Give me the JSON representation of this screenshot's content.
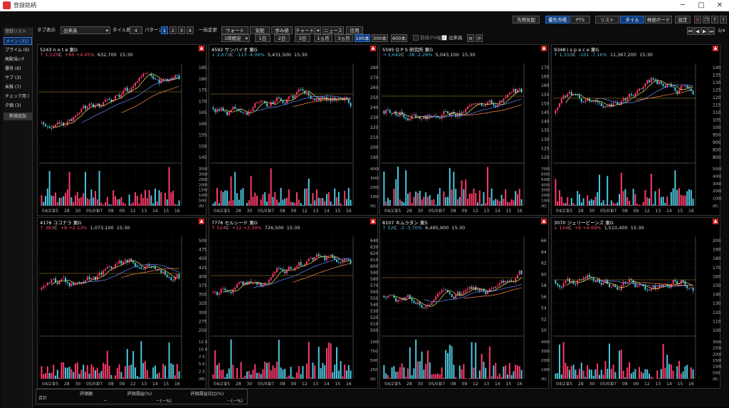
{
  "window": {
    "title": "登録銘柄",
    "min": "─",
    "max": "□",
    "close": "✕"
  },
  "topbar": {
    "buttons": [
      "先物気配",
      "優先市場",
      "PTS",
      "リスト",
      "タイル",
      "株価ボード",
      "設定"
    ],
    "active": [
      "優先市場",
      "タイル"
    ],
    "page": "3/4"
  },
  "toolbar": {
    "tab_display": "タブ表示",
    "sort": "出来高",
    "tile_label": "タイル数",
    "tile_count": "4",
    "pattern_label": "パターン",
    "patterns": [
      "1",
      "2",
      "3",
      "4"
    ],
    "pattern_active": "1",
    "bulk_change": "一括変更",
    "tabs": [
      "ウォート",
      "気配",
      "歩み値",
      "チャート",
      "ニュース",
      "信用"
    ],
    "interval": "1時間足",
    "ranges": [
      "1日",
      "2日",
      "3日",
      "1ヵ月",
      "3ヵ月",
      "100本",
      "300本",
      "600本"
    ],
    "range_active": "100本",
    "chk_ma": "前値3%幅",
    "chk_vol": "出来高"
  },
  "sidebar": {
    "header": "登録リスト",
    "items": [
      "メイン (31)",
      "プライム (6)",
      "高配当ｪｯﾁ",
      "優待 (6)",
      "サブ (3)",
      "米株 (7)",
      "チェック用 (",
      "夕鎮 (3)"
    ],
    "selected": 0,
    "add": "新規追加"
  },
  "panels": [
    {
      "code": "5243",
      "name": "n o t e",
      "mkt": "東G",
      "arrow": "↑",
      "price": "1,525",
      "flag": "C",
      "chg": "+65",
      "pct": "+4.45%",
      "vol": "632,700",
      "time": "15:30",
      "dir": "up"
    },
    {
      "code": "4592",
      "name": "サンバイオ",
      "mkt": "東G",
      "arrow": "↓",
      "price": "2,673",
      "flag": "C",
      "chg": "-113",
      "pct": "-4.06%",
      "vol": "5,431,500",
      "time": "15:30",
      "dir": "dn"
    },
    {
      "code": "5595",
      "name": "Q P S 研究所",
      "mkt": "東G",
      "arrow": "→",
      "price": "1,642",
      "flag": "C",
      "chg": "-38",
      "pct": "-2.26%",
      "vol": "5,043,100",
      "time": "15:30",
      "dir": "dn"
    },
    {
      "code": "9348",
      "name": "i s p a c e",
      "mkt": "東G",
      "arrow": "↑",
      "price": "1,310",
      "flag": "C",
      "chg": "-101",
      "pct": "-7.16%",
      "vol": "11,367,200",
      "time": "15:30",
      "dir": "dn"
    },
    {
      "code": "4176",
      "name": "ココナラ",
      "mkt": "東G",
      "arrow": "↑",
      "price": "383",
      "flag": "C",
      "chg": "+8",
      "pct": "+2.13%",
      "vol": "1,073,100",
      "time": "15:30",
      "dir": "up"
    },
    {
      "code": "7776",
      "name": "セルシード",
      "mkt": "東G",
      "arrow": "↑",
      "price": "524",
      "flag": "C",
      "chg": "+12",
      "pct": "+2.34%",
      "vol": "726,500",
      "time": "15:30",
      "dir": "up"
    },
    {
      "code": "8107",
      "name": "キムラタン",
      "mkt": "東S",
      "arrow": "↑",
      "price": "52",
      "flag": "C",
      "chg": "-2",
      "pct": "-3.70%",
      "vol": "6,495,900",
      "time": "15:30",
      "dir": "dn"
    },
    {
      "code": "3070",
      "name": "ジェリービーンズ",
      "mkt": "東G",
      "arrow": "↓",
      "price": "134",
      "flag": "C",
      "chg": "+6",
      "pct": "+4.69%",
      "vol": "1,510,400",
      "time": "15:30",
      "dir": "up"
    }
  ],
  "chart_data": [
    {
      "type": "candlestick",
      "price_ticks": [
        "1850",
        "1800",
        "1750",
        "1700",
        "1650",
        "1600",
        "1550",
        "1500",
        "1450"
      ],
      "vol_ticks": [
        "3500",
        "3000",
        "2500",
        "2000",
        "1500",
        "1000",
        "500",
        "(K)"
      ],
      "x_ticks": [
        "04/23",
        "25",
        "28",
        "30",
        "05/01",
        "07",
        "08",
        "09",
        "12",
        "13",
        "14",
        "15",
        "16"
      ]
    },
    {
      "type": "candlestick",
      "price_ticks": [
        "2800",
        "2700",
        "2600",
        "2500",
        "2400",
        "2300",
        "2200",
        "2100",
        "2000",
        "1900"
      ],
      "vol_ticks": [
        "4000",
        "3000",
        "2000",
        "1000",
        "(K)"
      ],
      "x_ticks": [
        "04/23",
        "25",
        "28",
        "30",
        "05/01",
        "07",
        "08",
        "09",
        "12",
        "13",
        "14",
        "15",
        "16"
      ]
    },
    {
      "type": "candlestick",
      "price_ticks": [
        "1700",
        "1650",
        "1600",
        "1550",
        "1500",
        "1450",
        "1400",
        "1350",
        "1300",
        "1250",
        "1200"
      ],
      "vol_ticks": [
        "7000",
        "6000",
        "5000",
        "4000",
        "3000",
        "2000",
        "1000",
        "(K)"
      ],
      "x_ticks": [
        "04/23",
        "25",
        "28",
        "30",
        "05/01",
        "07",
        "08",
        "09",
        "12",
        "13",
        "14",
        "15",
        "16"
      ]
    },
    {
      "type": "candlestick",
      "price_ticks": [
        "1400",
        "1350",
        "1300",
        "1250",
        "1200",
        "1150",
        "1100",
        "1050",
        "1000",
        "950",
        "900",
        "850",
        "800"
      ],
      "vol_ticks": [
        "5000",
        "4000",
        "3000",
        "2000",
        "1000",
        "(K)"
      ],
      "x_ticks": [
        "04/23",
        "25",
        "28",
        "30",
        "05/01",
        "07",
        "08",
        "09",
        "12",
        "13",
        "14",
        "15",
        "16"
      ]
    },
    {
      "type": "candlestick",
      "price_ticks": [
        "500",
        "475",
        "450",
        "425",
        "400",
        "375",
        "350",
        "325",
        "300",
        "275",
        "250"
      ],
      "vol_ticks": [
        "12.5",
        "10.0",
        "7.5",
        "5.0",
        "2.5",
        "(M)"
      ],
      "x_ticks": [
        "04/23",
        "25",
        "28",
        "30",
        "05/01",
        "07",
        "08",
        "09",
        "12",
        "13",
        "14",
        "15",
        "16"
      ]
    },
    {
      "type": "candlestick",
      "price_ticks": [
        "640",
        "630",
        "620",
        "610",
        "600",
        "590",
        "580",
        "570",
        "560",
        "550",
        "540",
        "530",
        "520",
        "510",
        "500"
      ],
      "vol_ticks": [
        "1000",
        "750",
        "500",
        "250",
        "(K)"
      ],
      "x_ticks": [
        "04/23",
        "25",
        "28",
        "30",
        "05/01",
        "07",
        "08",
        "09",
        "12",
        "13",
        "14",
        "15",
        "16"
      ]
    },
    {
      "type": "candlestick",
      "price_ticks": [
        "66",
        "64",
        "62",
        "60",
        "58",
        "56",
        "54",
        "52",
        "50"
      ],
      "vol_ticks": [
        "4000",
        "3000",
        "2000",
        "1000",
        "(K)"
      ],
      "x_ticks": [
        "04/23",
        "25",
        "28",
        "30",
        "05/01",
        "07",
        "08",
        "09",
        "12",
        "13",
        "14",
        "15",
        "16"
      ]
    },
    {
      "type": "candlestick",
      "price_ticks": [
        "200",
        "190",
        "180",
        "170",
        "160",
        "150",
        "140",
        "130",
        "120",
        "110",
        "100"
      ],
      "vol_ticks": [
        "3000",
        "2500",
        "2000",
        "1500",
        "1000",
        "500",
        "(K)"
      ],
      "x_ticks": [
        "04/23",
        "25",
        "28",
        "30",
        "05/01",
        "07",
        "08",
        "09",
        "12",
        "13",
        "14",
        "15",
        "16"
      ]
    }
  ],
  "bottom": {
    "label": "合計",
    "headers": [
      "評価額",
      "評価損益(%)",
      "評価損益日比(%)"
    ],
    "values": [
      "－",
      "－(－%)",
      "－(－%)"
    ]
  },
  "colors": {
    "up": "#ff3b6b",
    "down": "#4cc9e0",
    "accent": "#2f6fc8"
  }
}
